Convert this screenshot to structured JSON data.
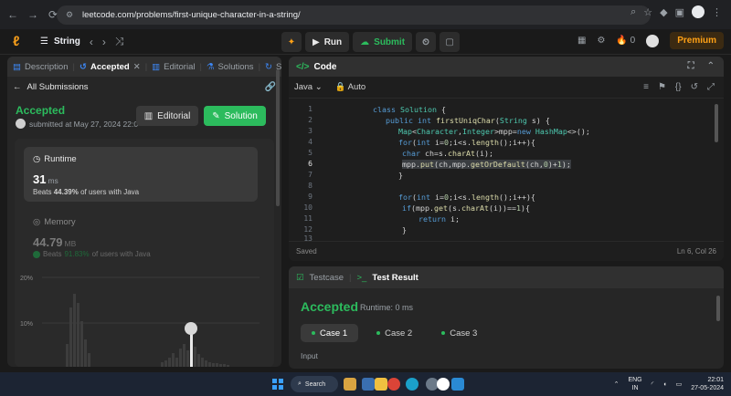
{
  "browser": {
    "url": "leetcode.com/problems/first-unique-character-in-a-string/"
  },
  "header": {
    "problem_list": "String",
    "run": "Run",
    "submit": "Submit",
    "streak": "0",
    "premium": "Premium"
  },
  "left": {
    "tabs": [
      {
        "label": "Description"
      },
      {
        "label": "Accepted"
      },
      {
        "label": "Editorial"
      },
      {
        "label": "Solutions"
      },
      {
        "label": "Su"
      }
    ],
    "all_submissions": "All Submissions",
    "status": "Accepted",
    "submitted": "submitted at May 27, 2024 22:0",
    "editorial_btn": "Editorial",
    "solution_btn": "Solution",
    "runtime": {
      "label": "Runtime",
      "value": "31",
      "unit": "ms",
      "beats_prefix": "Beats",
      "beats_pct": "44.39%",
      "beats_suffix": "of users with Java"
    },
    "memory": {
      "label": "Memory",
      "value": "44.79",
      "unit": "MB",
      "beats_prefix": "Beats",
      "beats_pct": "91.83%",
      "beats_suffix": "of users with Java"
    },
    "chart_labels": [
      "20%",
      "10%"
    ]
  },
  "editor": {
    "title": "Code",
    "language": "Java",
    "mode": "Auto",
    "status": "Saved",
    "position": "Ln 6, Col 26"
  },
  "result": {
    "tab_testcase": "Testcase",
    "tab_result": "Test Result",
    "status": "Accepted",
    "runtime": "Runtime: 0 ms",
    "cases": [
      "Case 1",
      "Case 2",
      "Case 3"
    ],
    "input_label": "Input"
  },
  "taskbar": {
    "search": "Search",
    "lang_top": "ENG",
    "lang_bottom": "IN",
    "time": "22:01",
    "date": "27-05-2024"
  }
}
